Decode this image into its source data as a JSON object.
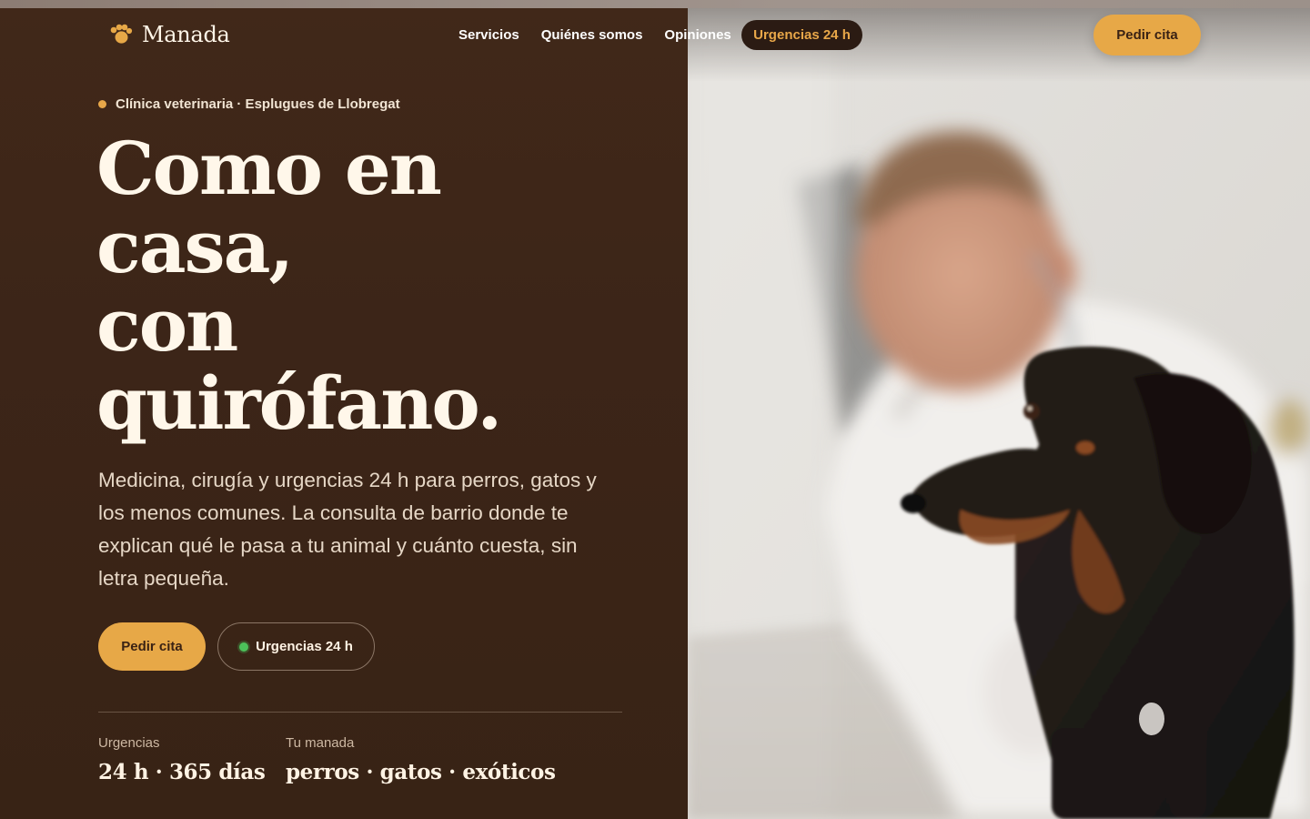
{
  "brand": {
    "name": "Manada",
    "icon": "paw-icon"
  },
  "nav": {
    "links": [
      {
        "label": "Servicios"
      },
      {
        "label": "Quiénes somos"
      },
      {
        "label": "Opiniones"
      }
    ],
    "emergency_pill": "Urgencias 24 h",
    "cta": "Pedir cita"
  },
  "hero": {
    "eyebrow": "Clínica veterinaria · Esplugues de Llobregat",
    "headline": [
      "Como en",
      "casa,",
      "con",
      "quirófano."
    ],
    "lead": "Medicina, cirugía y urgencias 24 h para perros, gatos y los menos comunes. La consulta de barrio donde te explican qué le pasa a tu animal y cuánto cuesta, sin letra pequeña.",
    "primary_button": "Pedir cita",
    "secondary_button": "Urgencias 24 h"
  },
  "stats": [
    {
      "label": "Urgencias",
      "value": "24 h · 365 días"
    },
    {
      "label": "Tu manada",
      "value": "perros · gatos · exóticos"
    }
  ],
  "colors": {
    "panel_brown": "#3c2518",
    "accent_amber": "#e7a847",
    "cream_text": "#fff7ea",
    "status_green": "#4cc25a"
  }
}
